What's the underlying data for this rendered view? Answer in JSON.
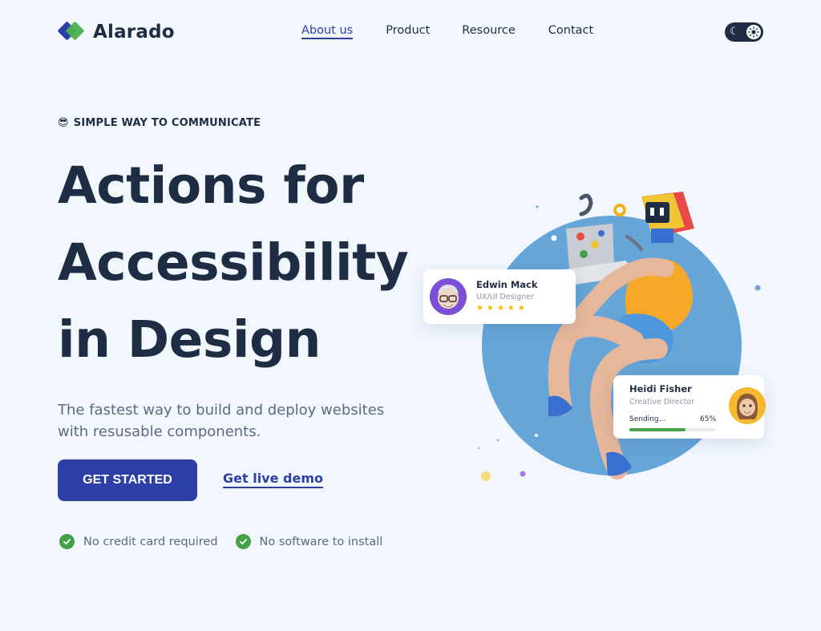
{
  "brand": {
    "name": "Alarado",
    "colors": {
      "primary": "#2c3ea8",
      "accent": "#4caf50",
      "dark": "#1f2d44"
    }
  },
  "nav": {
    "items": [
      {
        "label": "About us",
        "active": true
      },
      {
        "label": "Product",
        "active": false
      },
      {
        "label": "Resource",
        "active": false
      },
      {
        "label": "Contact",
        "active": false
      }
    ]
  },
  "theme_toggle": {
    "icons": [
      "moon-icon",
      "sun-icon"
    ]
  },
  "hero": {
    "eyebrow_emoji": "😎",
    "eyebrow": "SIMPLE WAY TO COMMUNICATE",
    "headline_lines": [
      "Actions for",
      "Accessibility",
      "in Design"
    ],
    "subtitle": "The fastest way to build and deploy websites with resusable components.",
    "cta_primary": "GET STARTED",
    "cta_secondary": "Get live demo",
    "checks": [
      "No credit card required",
      "No software to install"
    ]
  },
  "cards": {
    "card1": {
      "name": "Edwin Mack",
      "role": "UX/UI Designer",
      "stars": "★★★★★",
      "rating": 5
    },
    "card2": {
      "name": "Heidi Fisher",
      "role": "Creative Director",
      "status": "Sending...",
      "progress_label": "65%",
      "progress": 0.65
    }
  }
}
